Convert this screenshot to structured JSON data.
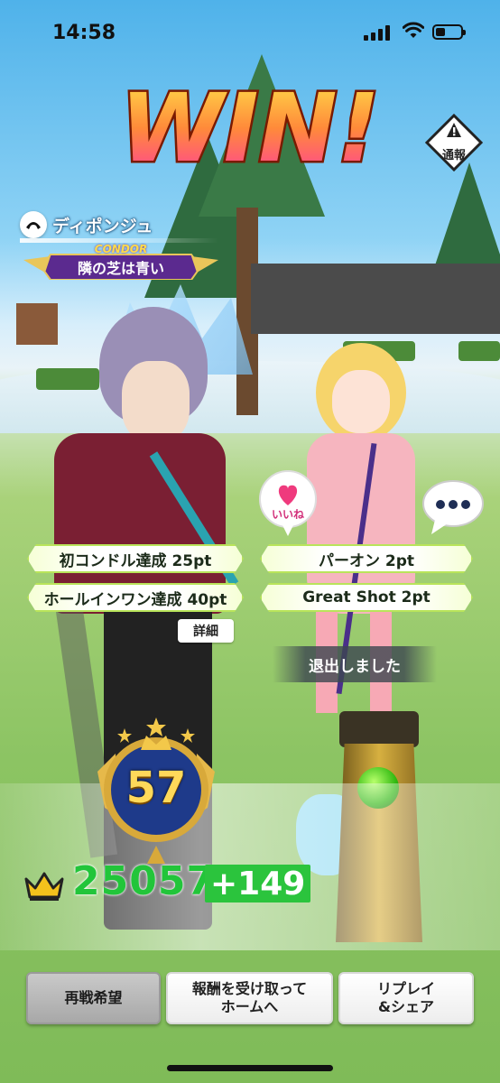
{
  "status_bar": {
    "time": "14:58"
  },
  "result": {
    "headline": "WIN!"
  },
  "report_button": {
    "label": "通報"
  },
  "player": {
    "name": "ディポンジュ",
    "rank_emblem": "CONDOR",
    "title": "隣の芝は青い",
    "achievements": [
      {
        "label": "初コンドル達成 25pt"
      },
      {
        "label": "ホールインワン達成 40pt"
      }
    ],
    "detail_button": "詳細",
    "level": "57",
    "score": "25057",
    "score_delta": "+149"
  },
  "opponent": {
    "achievements": [
      {
        "label": "パーオン 2pt"
      },
      {
        "label": "Great Shot 2pt"
      }
    ],
    "status": "退出しました"
  },
  "reactions": {
    "like_label": "いいね",
    "chat_icon": "speech-bubble-ellipsis-icon"
  },
  "buttons": {
    "rematch": "再戦希望",
    "collect_reward": "報酬を受け取って\nホームへ",
    "replay_share": "リプレイ\n&シェア"
  },
  "colors": {
    "accent_green": "#22c53a",
    "banner_border": "#b9e45a",
    "win_gradient_top": "#ffe44a",
    "win_gradient_bottom": "#ff3aa0"
  }
}
